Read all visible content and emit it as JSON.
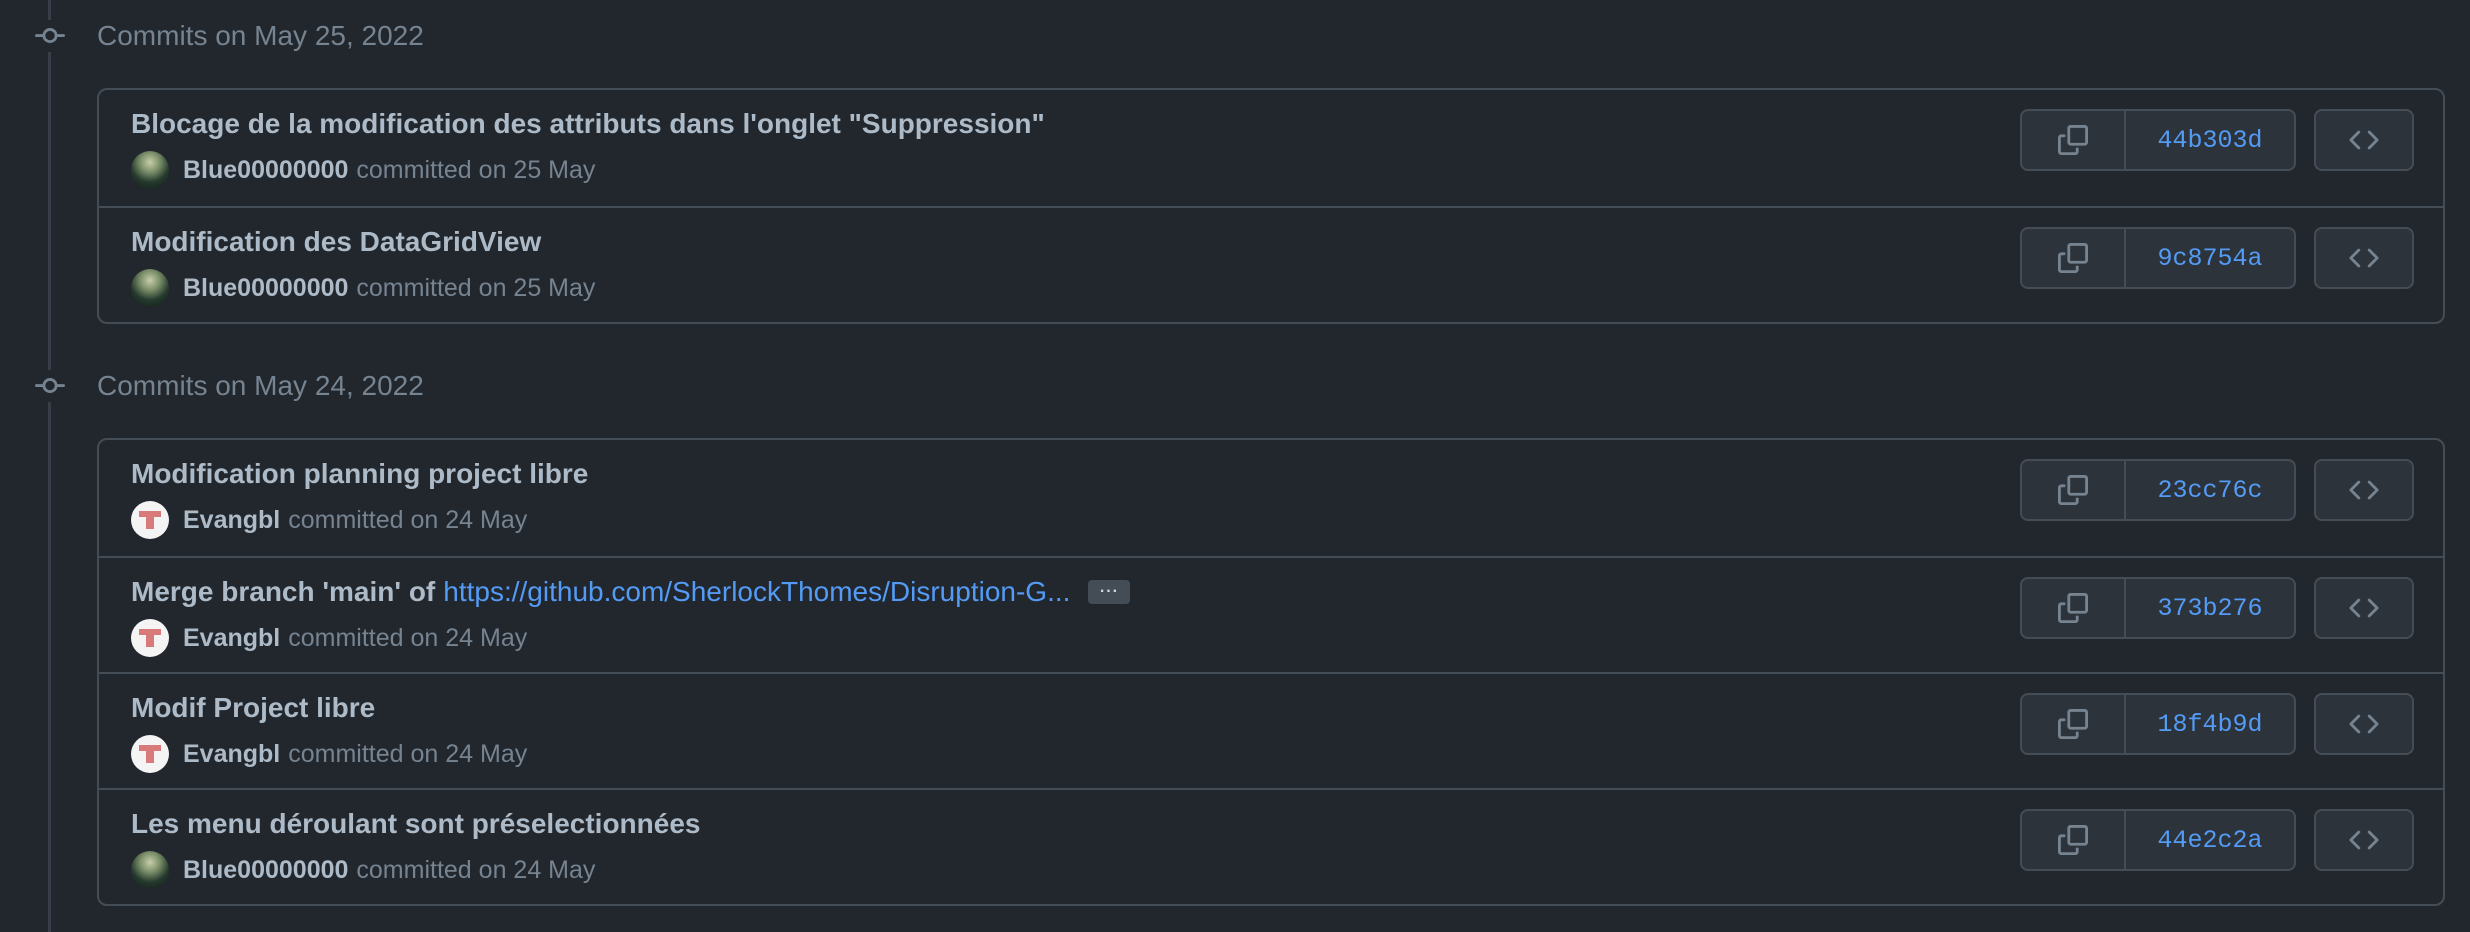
{
  "groups": [
    {
      "title": "Commits on May 25, 2022",
      "commits": [
        {
          "message": "Blocage de la modification des attributs dans l'onglet \"Suppression\"",
          "author": "Blue00000000",
          "date_text": "committed on 25 May",
          "sha": "44b303d",
          "avatar": "blue"
        },
        {
          "message": "Modification des DataGridView",
          "author": "Blue00000000",
          "date_text": "committed on 25 May",
          "sha": "9c8754a",
          "avatar": "blue"
        }
      ]
    },
    {
      "title": "Commits on May 24, 2022",
      "commits": [
        {
          "message": "Modification planning project libre",
          "author": "Evangbl",
          "date_text": "committed on 24 May",
          "sha": "23cc76c",
          "avatar": "evan"
        },
        {
          "message_prefix": "Merge branch 'main' of",
          "message_link": "https://github.com/SherlockThomes/Disruption-G...",
          "ellipsis": "···",
          "author": "Evangbl",
          "date_text": "committed on 24 May",
          "sha": "373b276",
          "avatar": "evan"
        },
        {
          "message": "Modif Project libre",
          "author": "Evangbl",
          "date_text": "committed on 24 May",
          "sha": "18f4b9d",
          "avatar": "evan"
        },
        {
          "message": "Les menu déroulant sont préselectionnées",
          "author": "Blue00000000",
          "date_text": "committed on 24 May",
          "sha": "44e2c2a",
          "avatar": "blue"
        }
      ]
    }
  ],
  "icons": {
    "timeline": "git-commit-icon",
    "copy": "copy-icon",
    "browse": "code-icon"
  },
  "colors": {
    "background": "#22272e",
    "border": "#444c56",
    "link": "#539bf5",
    "muted": "#768390",
    "text": "#adbac7"
  }
}
